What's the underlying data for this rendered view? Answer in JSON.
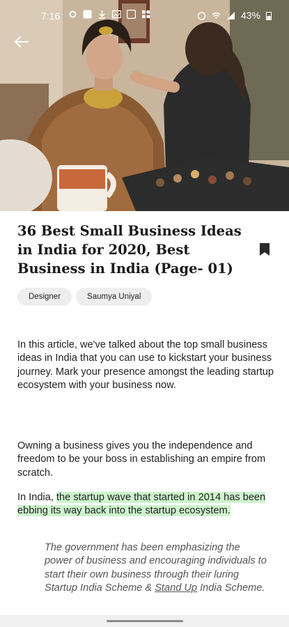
{
  "status_bar": {
    "time": "7:16",
    "battery": "43%"
  },
  "article": {
    "title": "36 Best Small Business Ideas in India for 2020, Best Business in India (Page- 01)",
    "tags": [
      "Designer",
      "Saumya Uniyal"
    ],
    "intro": "In this article, we've talked about the top small business ideas in India that you can use to kickstart your business journey. Mark your presence amongst the leading startup ecosystem with your business now.",
    "para2": "Owning a business gives you the independence and freedom to be your boss in establishing an empire from scratch.",
    "para3_prefix": "In India, ",
    "para3_highlight": "the startup wave that started in 2014 has been ebbing its way back into the startup ecosystem.",
    "quote_prefix": "The government has been emphasizing the power of business and encouraging individuals to start their own business through their luring Startup India Scheme & ",
    "quote_link": "Stand Up",
    "quote_suffix": " India Scheme."
  },
  "colors": {
    "highlight": "#cdf5cd",
    "hero_background": "#b9a58c"
  },
  "icons": {
    "back": "back-arrow-icon",
    "bookmark": "bookmark-icon"
  }
}
